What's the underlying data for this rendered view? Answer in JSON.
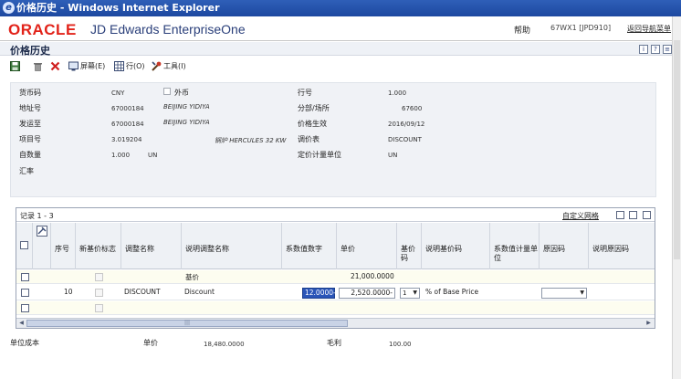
{
  "window": {
    "title": "价格历史 - Windows Internet Explorer"
  },
  "app": {
    "logo": "ORACLE",
    "product": "JD Edwards EnterpriseOne",
    "help": "帮助",
    "environment": "67WX1 [JPD910]",
    "return_link": "返回导航菜单"
  },
  "form": {
    "title": "价格历史"
  },
  "toolbar": {
    "screen_label": "屏幕(E)",
    "row_label": "行(O)",
    "tools_label": "工具(I)"
  },
  "header": {
    "currency_code": {
      "label": "货币码",
      "value": "CNY"
    },
    "foreign_label": "外币",
    "line_number": {
      "label": "行号",
      "value": "1.000"
    },
    "address_number": {
      "label": "地址号",
      "value": "67000184",
      "name": "BEIJING YIDIYA"
    },
    "branch_plant": {
      "label": "分部/场所",
      "value": "67600"
    },
    "ship_to": {
      "label": "发运至",
      "value": "67000184",
      "name": "BEIJING YIDIYA"
    },
    "price_effective": {
      "label": "价格生效",
      "value": "2016/09/12"
    },
    "item_number": {
      "label": "项目号",
      "value": "3.019204",
      "desc": "锅炉 HERCULES 32 KW"
    },
    "adjustment_table": {
      "label": "调价表",
      "value": "DISCOUNT"
    },
    "quantity": {
      "label": "自数量",
      "value": "1.000",
      "uom": "UN"
    },
    "pricing_uom": {
      "label": "定价计量单位",
      "value": "UN"
    },
    "exchange_rate": {
      "label": "汇率"
    }
  },
  "grid": {
    "records": "记录 1 - 3",
    "customize": "自定义网格",
    "columns": {
      "seq": "序号",
      "new_base": "新基价标志",
      "adj_name": "调整名称",
      "desc_adj_name": "说明调整名称",
      "factor": "系数值数字",
      "unit_price": "单价",
      "base_code": "基价码",
      "desc_base_code": "说明基价码",
      "factor_uom": "系数值计量单位",
      "reason_code": "原因码",
      "desc_reason": "说明原因码"
    },
    "rows": [
      {
        "desc": "基价",
        "unit_price": "21,000.0000"
      },
      {
        "seq": "10",
        "adj_name": "DISCOUNT",
        "desc": "Discount",
        "factor": "12.0000-",
        "unit_price": "2,520.0000-",
        "base_code": "1",
        "desc_base_code": "% of Base Price"
      },
      {}
    ]
  },
  "footer": {
    "unit_cost_label": "单位成本",
    "unit_price_label": "单价",
    "unit_price_value": "18,480.0000",
    "margin_label": "毛利",
    "margin_value": "100.00"
  },
  "colors": {
    "oracle_red": "#e2231a",
    "selection": "#2a55b8"
  }
}
